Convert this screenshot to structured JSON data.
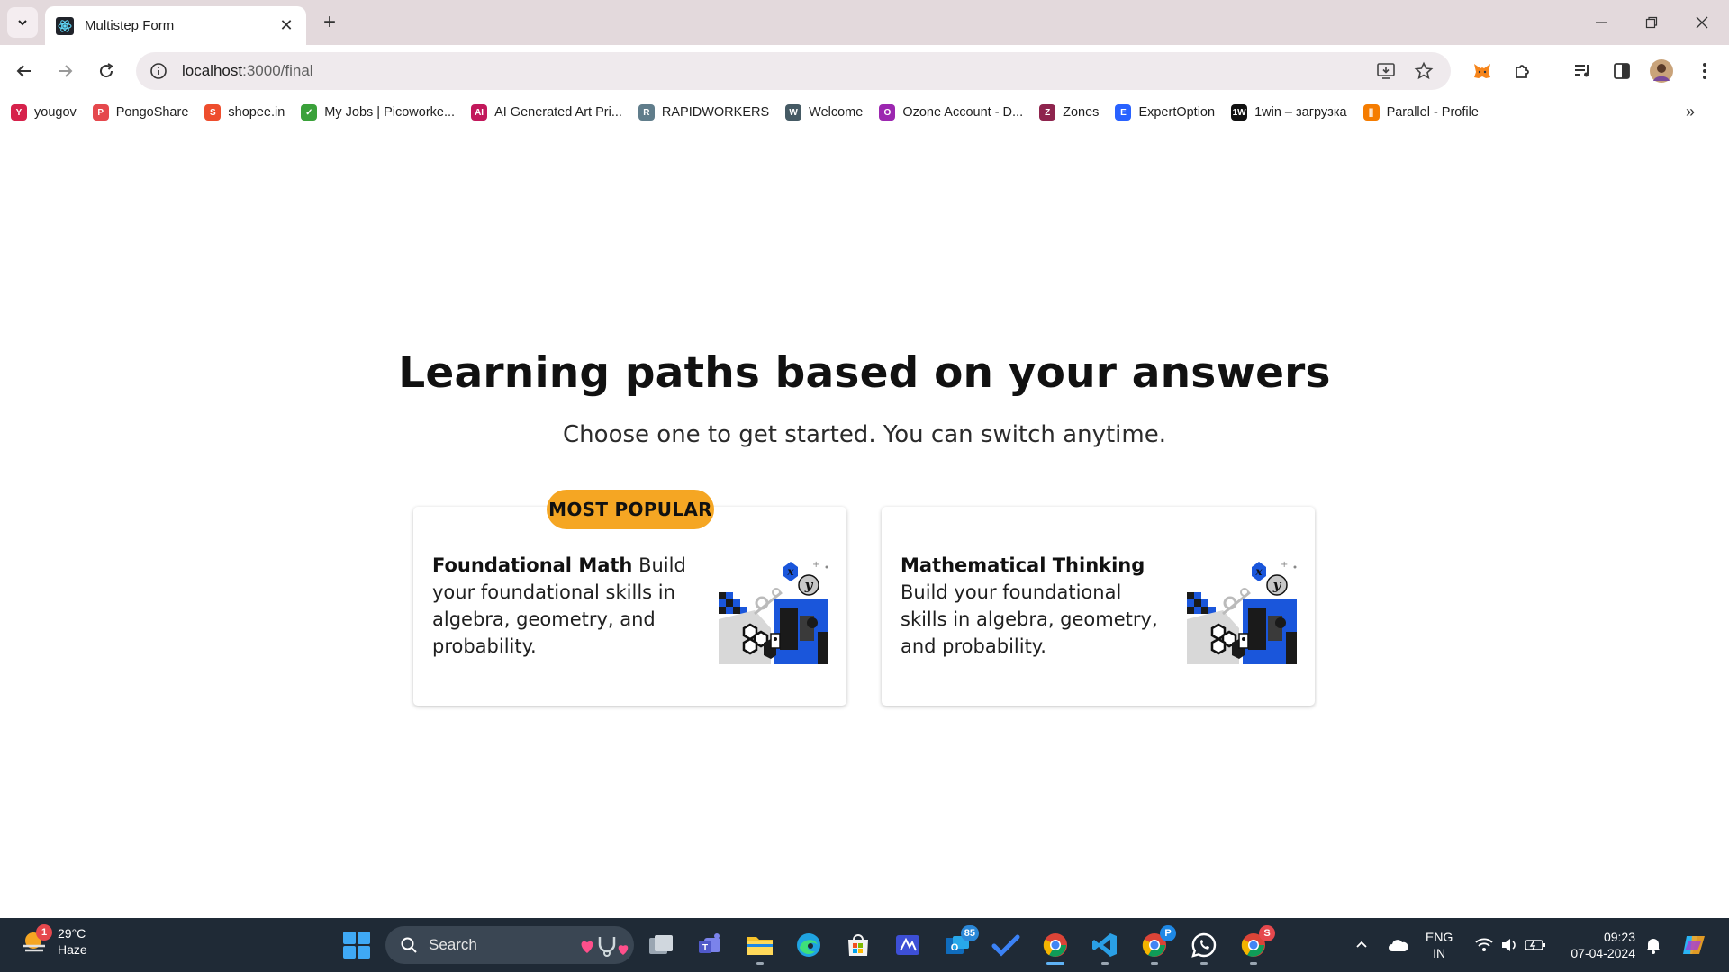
{
  "browser": {
    "tab_title": "Multistep Form",
    "url_host": "localhost",
    "url_path": ":3000/final",
    "bookmarks": [
      {
        "label": "yougov",
        "icon": "yougov-icon",
        "color": "#d6224b",
        "glyph": "Y"
      },
      {
        "label": "PongoShare",
        "icon": "pongoshare-icon",
        "color": "#e5484d",
        "glyph": "P"
      },
      {
        "label": "shopee.in",
        "icon": "shopee-icon",
        "color": "#ee4d2d",
        "glyph": "S"
      },
      {
        "label": "My Jobs | Picoworke...",
        "icon": "picoworkers-icon",
        "color": "#3aa13a",
        "glyph": "✓"
      },
      {
        "label": "AI Generated Art Pri...",
        "icon": "ai-art-icon",
        "color": "#c2185b",
        "glyph": "AI"
      },
      {
        "label": "RAPIDWORKERS",
        "icon": "rapidworkers-icon",
        "color": "#607d8b",
        "glyph": "R"
      },
      {
        "label": "Welcome",
        "icon": "welcome-icon",
        "color": "#455a64",
        "glyph": "W"
      },
      {
        "label": "Ozone Account - D...",
        "icon": "ozone-icon",
        "color": "#9c27b0",
        "glyph": "O"
      },
      {
        "label": "Zones",
        "icon": "zones-icon",
        "color": "#8e244d",
        "glyph": "Z"
      },
      {
        "label": "ExpertOption",
        "icon": "expertoption-icon",
        "color": "#2962ff",
        "glyph": "E"
      },
      {
        "label": "1win – загрузка",
        "icon": "1win-icon",
        "color": "#111111",
        "glyph": "1W"
      },
      {
        "label": "Parallel - Profile",
        "icon": "parallel-icon",
        "color": "#f57c00",
        "glyph": "||"
      }
    ]
  },
  "main": {
    "title": "Learning paths based on your answers",
    "subtitle": "Choose one to get started. You can switch anytime.",
    "badge": "MOST POPULAR",
    "cards": [
      {
        "title": "Foundational Math",
        "description": " Build your foundational skills in algebra, geometry, and probability."
      },
      {
        "title": "Mathematical Thinking",
        "description": " Build your foundational skills in algebra, geometry, and probability."
      }
    ]
  },
  "taskbar": {
    "temperature": "29°C",
    "weather": "Haze",
    "weather_badge": "1",
    "search_label": "Search",
    "mail_badge": "85",
    "chrome_badge_p": "P",
    "chrome_badge_s": "S",
    "lang_line1": "ENG",
    "lang_line2": "IN",
    "time": "09:23",
    "date": "07-04-2024"
  },
  "colors": {
    "accent_badge": "#f5a623",
    "taskbar": "#1f2a36",
    "art_blue": "#1a56db"
  }
}
